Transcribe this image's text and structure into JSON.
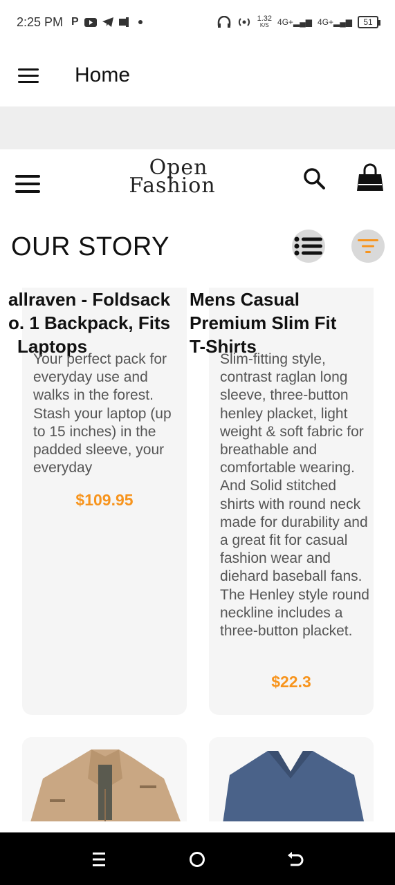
{
  "status_bar": {
    "time": "2:25 PM",
    "net_speed": "1.32",
    "net_unit": "K/S",
    "signal1": "4G+",
    "signal2": "4G+",
    "battery": "51"
  },
  "app_bar": {
    "title": "Home"
  },
  "store_header": {
    "logo_line1": "Open",
    "logo_line2": "Fashion"
  },
  "section": {
    "title": "OUR STORY"
  },
  "products": [
    {
      "title_lines": [
        "allraven - Foldsack",
        "o. 1 Backpack, Fits",
        "Laptops"
      ],
      "description": "Your perfect pack for everyday use and walks in the forest. Stash your laptop (up to 15 inches) in the padded sleeve, your everyday",
      "price": "$109.95"
    },
    {
      "title_lines": [
        "Mens Casual",
        "Premium Slim Fit",
        "T-Shirts"
      ],
      "description": "Slim-fitting style, contrast raglan long sleeve, three-button henley placket, light weight & soft fabric for breathable and comfortable wearing. And Solid stitched shirts with round neck made for durability and a great fit for casual fashion wear and diehard baseball fans. The Henley style round neckline includes a three-button placket.",
      "price": "$22.3"
    }
  ],
  "icons": {
    "menu": "hamburger-icon",
    "search": "search-icon",
    "bag": "shopping-bag-icon",
    "list": "list-view-icon",
    "filter": "filter-icon"
  },
  "colors": {
    "accent": "#f7941d",
    "card_bg": "#f5f5f5"
  }
}
